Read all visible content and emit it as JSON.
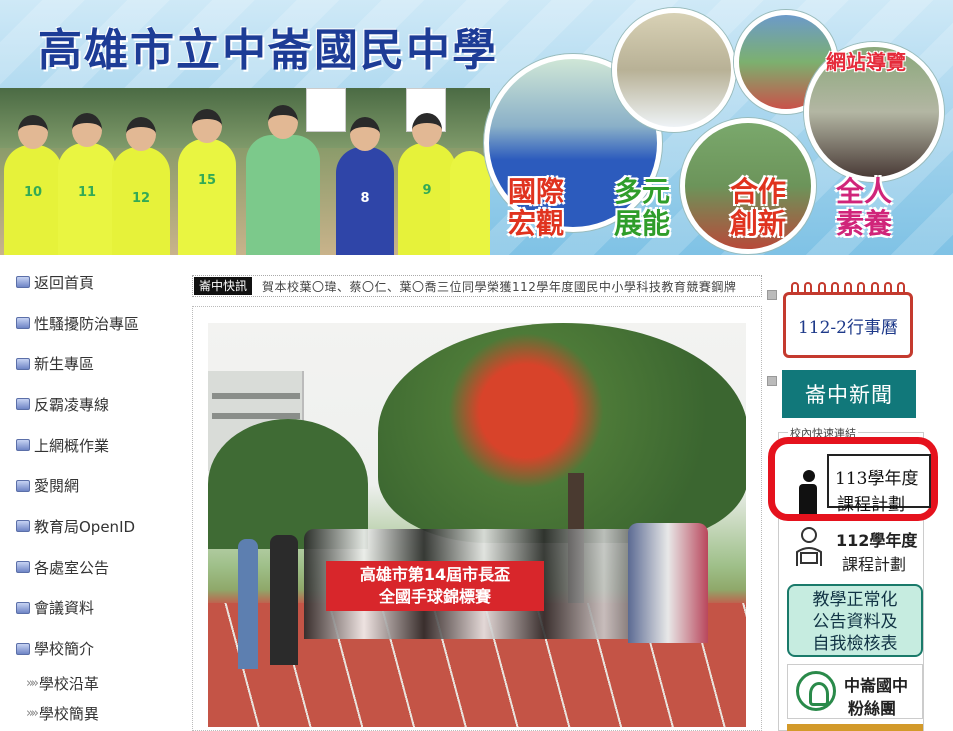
{
  "banner": {
    "school_name": "高雄市立中崙國民中學",
    "sitemap": "網站導覽",
    "slogans": [
      "國際宏觀",
      "多元展能",
      "合作創新",
      "全人素養"
    ],
    "player_numbers": [
      "10",
      "11",
      "12",
      "15",
      "8",
      "9"
    ]
  },
  "leftnav": {
    "items": [
      {
        "label": "返回首頁"
      },
      {
        "label": "性騷擾防治專區"
      },
      {
        "label": "新生專區"
      },
      {
        "label": "反霸凌專線"
      },
      {
        "label": "上網概作業"
      },
      {
        "label": "愛閱網"
      },
      {
        "label": "教育局OpenID"
      },
      {
        "label": "各處室公告"
      },
      {
        "label": "會議資料"
      },
      {
        "label": "學校簡介"
      }
    ],
    "subitems": [
      {
        "label": "學校沿革"
      },
      {
        "label": "學校簡異"
      }
    ]
  },
  "ticker": {
    "tag": "崙中快訊",
    "text": "賀本校葉〇瑋、蔡〇仁、葉〇喬三位同學榮獲112學年度國民中小學科技教育競賽鋼牌"
  },
  "main_photo": {
    "banner_line1": "高雄市第14屆市長盃",
    "banner_line2": "全國手球錦標賽"
  },
  "rightcol": {
    "calendar_label": "112-2行事曆",
    "news_label": "崙中新聞",
    "quicklinks_label": "校內快速連結",
    "plan113_line1": "113學年度",
    "plan113_line2": "課程計劃",
    "plan112_line1": "112學年度",
    "plan112_line2": "課程計劃",
    "normalize_lines": [
      "教學正常化",
      "公告資料及",
      "自我檢核表"
    ],
    "fans_line1": "中崙國中",
    "fans_line2": "粉絲團"
  },
  "colors": {
    "title_blue": "#1d3c96",
    "news_teal": "#11787a",
    "highlight_red": "#e5121d",
    "calendar_red": "#c43a2e"
  }
}
